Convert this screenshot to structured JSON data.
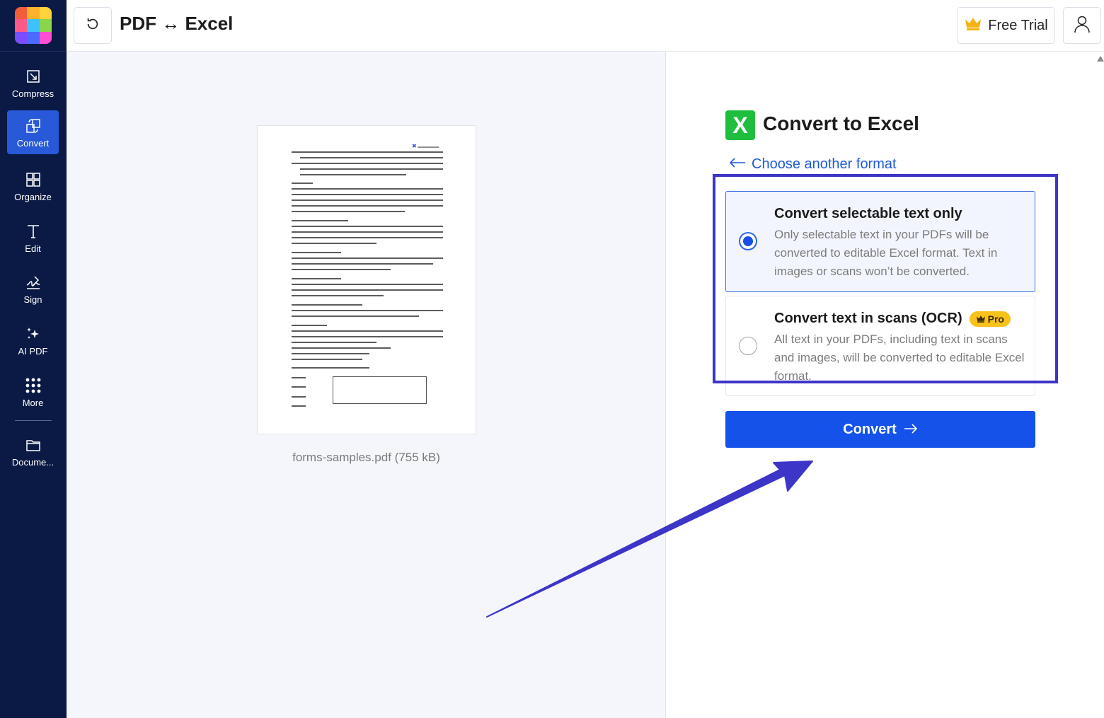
{
  "app": {
    "logo_colors": [
      "#f25c3b",
      "#ffb02e",
      "#ffd43b",
      "#ff5a8a",
      "#3ec1ff",
      "#8bd54a",
      "#7a4dff",
      "#4a6bff",
      "#ff4fd1"
    ]
  },
  "sidebar": {
    "items": [
      {
        "label": "Compress",
        "icon": "compress-icon"
      },
      {
        "label": "Convert",
        "icon": "convert-icon",
        "active": true
      },
      {
        "label": "Organize",
        "icon": "organize-icon"
      },
      {
        "label": "Edit",
        "icon": "edit-icon"
      },
      {
        "label": "Sign",
        "icon": "sign-icon"
      },
      {
        "label": "AI PDF",
        "icon": "ai-sparkle-icon"
      },
      {
        "label": "More",
        "icon": "more-grid-icon"
      },
      {
        "label": "Docume...",
        "icon": "folder-icon"
      }
    ]
  },
  "header": {
    "title": "PDF ↔ Excel",
    "free_trial_label": "Free Trial"
  },
  "preview": {
    "file_name": "forms-samples.pdf (755 kB)"
  },
  "panel": {
    "title": "Convert to Excel",
    "choose_format_label": "Choose another format",
    "options": [
      {
        "title": "Convert selectable text only",
        "description": "Only selectable text in your PDFs will be converted to editable Excel format. Text in images or scans won’t be converted.",
        "selected": true
      },
      {
        "title": "Convert text in scans (OCR)",
        "badge": "Pro",
        "description": "All text in your PDFs, including text in scans and images, will be converted to editable Excel format.",
        "selected": false
      }
    ],
    "convert_label": "Convert"
  },
  "colors": {
    "sidebar_bg": "#0a1a44",
    "active_nav": "#2759d8",
    "primary": "#1452ea",
    "excel_green": "#1fbe3e",
    "pro_badge": "#f7c21a",
    "annotation": "#3d35c7"
  }
}
